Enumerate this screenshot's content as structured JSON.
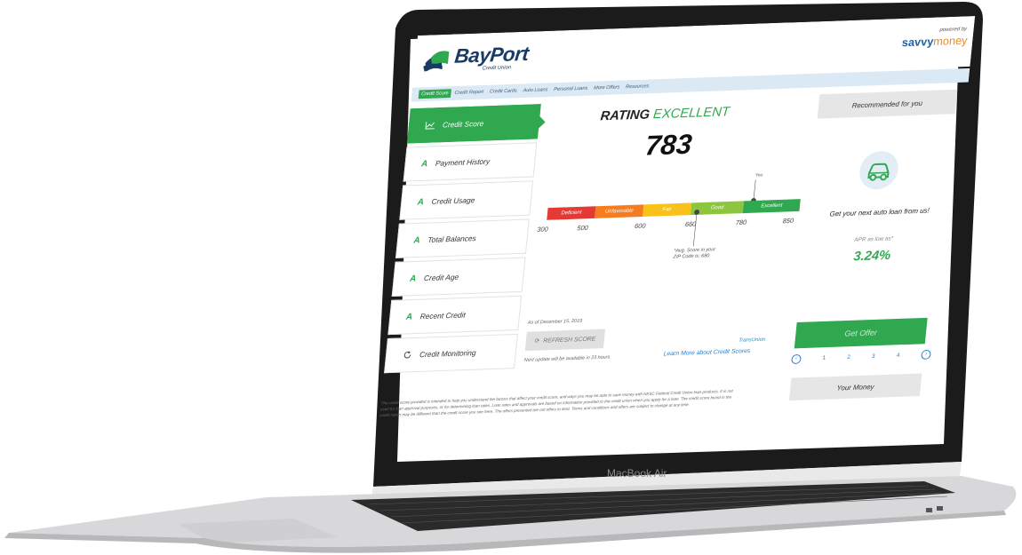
{
  "brand": {
    "name": "BayPort",
    "sub": "Credit Union",
    "powered_by": "powered by",
    "partner_a": "savvy",
    "partner_b": "money"
  },
  "nav": {
    "items": [
      "Credit Score",
      "Credit Report",
      "Credit Cards",
      "Auto Loans",
      "Personal Loans",
      "More Offers",
      "Resources"
    ],
    "active": 0
  },
  "side": {
    "credit_score": "Credit Score",
    "payment_history": {
      "grade": "A",
      "label": "Payment History"
    },
    "credit_usage": {
      "grade": "A",
      "label": "Credit Usage"
    },
    "total_balances": {
      "grade": "A",
      "label": "Total Balances"
    },
    "credit_age": {
      "grade": "A",
      "label": "Credit Age"
    },
    "recent_credit": {
      "grade": "A",
      "label": "Recent Credit"
    },
    "credit_monitoring": "Credit Monitoring"
  },
  "score": {
    "rating_prefix": "RATING",
    "rating_word": "EXCELLENT",
    "value": "783",
    "you": "You",
    "segments": [
      {
        "label": "Deficient",
        "color": "#e53935"
      },
      {
        "label": "Unfavorable",
        "color": "#f57c1f"
      },
      {
        "label": "Fair",
        "color": "#f9c21a"
      },
      {
        "label": "Good",
        "color": "#8cc63f"
      },
      {
        "label": "Excellent",
        "color": "#2fa84f"
      }
    ],
    "ticks": [
      "300",
      "500",
      "600",
      "660",
      "780",
      "850"
    ],
    "avg_line1": "*Avg. Score in your",
    "avg_line2": "ZIP Code is: 680",
    "as_of": "As of December 15, 2019",
    "refresh": "REFRESH SCORE",
    "next_update": "Next update will be available in 23 hours",
    "bureau": "TransUnion",
    "learn_more": "Learn More about Credit Scores"
  },
  "offers": {
    "heading": "Recommended for you",
    "headline": "Get your next auto loan from us!",
    "apr_label": "APR as low as*",
    "apr_value": "3.24%",
    "cta": "Get Offer",
    "pages": [
      "1",
      "2",
      "3",
      "4"
    ],
    "your_money": "Your Money"
  },
  "disclaimer": "The credit score provided is intended to help you understand the factors that affect your credit score, and ways you may be able to save money with NESC Federal Credit Union loan products. It is not used for loan approval purposes, or for determining loan rates. Loan rates and approvals are based on information provided to the credit union when you apply for a loan. The credit score found in the credit report may be different than the credit score you see here. The offers presented are not offers to lend. Terms and conditions and offers are subject to change at any time.",
  "device_label": "MacBook Air"
}
